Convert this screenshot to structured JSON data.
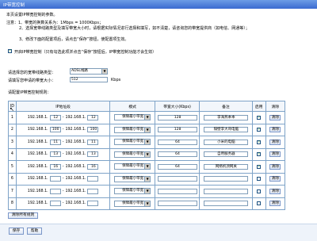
{
  "window": {
    "title": "IP带宽控制"
  },
  "intro": {
    "line1": "本页设置IP带宽控制的参数。",
    "line2": "注意：1、带宽的换算关系为：1Mbps = 1000Kbps；",
    "line3": "2、选择宽带线路类型及填写带宽大小时，请根据实际情况进行选择和填写，如不清楚，请咨询您的带宽提供商（如电信、网通等）；",
    "line4": "3、修改下面的配置项后，请点击“保存”按钮，使配置项生效。"
  },
  "enable": {
    "checked": true,
    "checkmark": "✓",
    "label": "开启IP带宽控制（只有勾选此项并点击“保存”按钮后，IP带宽控制功能才会生效）"
  },
  "line_type": {
    "label": "请选择您的宽带线路类型：",
    "value": "ADSL线路",
    "arrow": "▼"
  },
  "bandwidth": {
    "label": "请填写您申请的带宽大小：",
    "value": "512",
    "unit": "Kbps"
  },
  "rules": {
    "caption": "请配置IP带宽控制规则：",
    "headers": {
      "id": "ID",
      "ip": "IP地址段",
      "mode": "模式",
      "bw": "带宽大小(Kbps)",
      "note": "备注",
      "enabled": "启用",
      "delete": "清除"
    },
    "ip_prefix": "192.168.1.",
    "dash": "-",
    "delete_label": "清除",
    "rows": [
      {
        "id": "1",
        "start": "12",
        "end": "12",
        "mode": "保障最小带宽",
        "bw": "128",
        "note": "李海燕本本",
        "enabled": "✓"
      },
      {
        "id": "2",
        "start": "100",
        "end": "100",
        "mode": "保障最小带宽",
        "bw": "128",
        "note": "隔壁李大哥电脑",
        "enabled": "✓"
      },
      {
        "id": "3",
        "start": "11",
        "end": "11",
        "mode": "保障最小带宽",
        "bw": "64",
        "note": "小米的电脑",
        "enabled": "✓"
      },
      {
        "id": "4",
        "start": "13",
        "end": "13",
        "mode": "保障最小带宽",
        "bw": "64",
        "note": "自用服务器",
        "enabled": "✓"
      },
      {
        "id": "5",
        "start": "16",
        "end": "16",
        "mode": "保障最小带宽",
        "bw": "64",
        "note": "网络机顶网关",
        "enabled": "✓"
      },
      {
        "id": "6",
        "start": "",
        "end": "",
        "mode": "保障最小带宽",
        "bw": "",
        "note": "",
        "enabled": ""
      },
      {
        "id": "7",
        "start": "",
        "end": "",
        "mode": "保障最小带宽",
        "bw": "",
        "note": "",
        "enabled": ""
      },
      {
        "id": "8",
        "start": "",
        "end": "",
        "mode": "保障最小带宽",
        "bw": "",
        "note": "",
        "enabled": ""
      }
    ]
  },
  "buttons": {
    "clear_all": "清除所有规则",
    "save": "保存",
    "help": "帮助"
  }
}
